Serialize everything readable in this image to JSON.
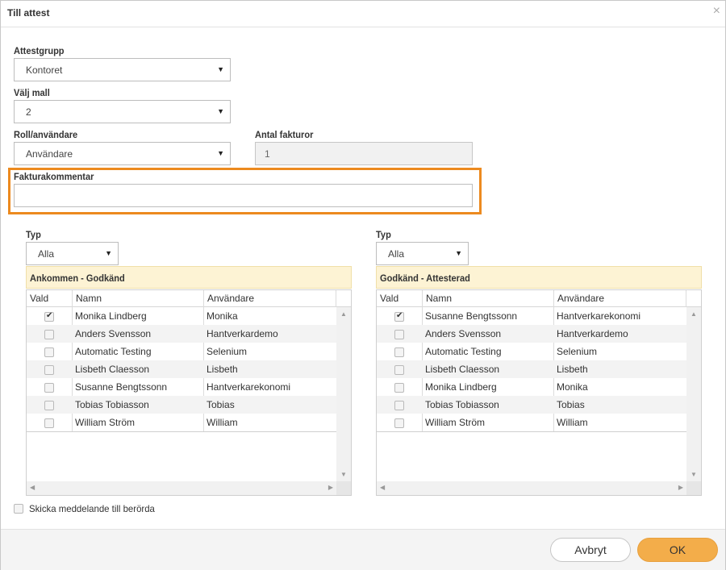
{
  "dialog": {
    "title": "Till attest",
    "close_icon": "×"
  },
  "form": {
    "attestgrupp": {
      "label": "Attestgrupp",
      "value": "Kontoret"
    },
    "valj_mall": {
      "label": "Välj mall",
      "value": "2"
    },
    "roll": {
      "label": "Roll/användare",
      "value": "Användare"
    },
    "antal_fakturor": {
      "label": "Antal fakturor",
      "value": "1"
    },
    "fakturakommentar": {
      "label": "Fakturakommentar",
      "value": "",
      "highlight_color": "#ec8a1f"
    }
  },
  "left_panel": {
    "typ_label": "Typ",
    "typ_value": "Alla",
    "header": "Ankommen - Godkänd",
    "columns": [
      "Vald",
      "Namn",
      "Användare"
    ],
    "rows": [
      {
        "checked": true,
        "namn": "Monika Lindberg",
        "anvandare": "Monika"
      },
      {
        "checked": false,
        "namn": "Anders Svensson",
        "anvandare": "Hantverkardemo"
      },
      {
        "checked": false,
        "namn": "Automatic Testing",
        "anvandare": "Selenium"
      },
      {
        "checked": false,
        "namn": "Lisbeth Claesson",
        "anvandare": "Lisbeth"
      },
      {
        "checked": false,
        "namn": "Susanne Bengtssonn",
        "anvandare": "Hantverkarekonomi"
      },
      {
        "checked": false,
        "namn": "Tobias Tobiasson",
        "anvandare": "Tobias"
      },
      {
        "checked": false,
        "namn": "William Ström",
        "anvandare": "William"
      }
    ]
  },
  "right_panel": {
    "typ_label": "Typ",
    "typ_value": "Alla",
    "header": "Godkänd - Attesterad",
    "columns": [
      "Vald",
      "Namn",
      "Användare"
    ],
    "rows": [
      {
        "checked": true,
        "namn": "Susanne Bengtssonn",
        "anvandare": "Hantverkarekonomi"
      },
      {
        "checked": false,
        "namn": "Anders Svensson",
        "anvandare": "Hantverkardemo"
      },
      {
        "checked": false,
        "namn": "Automatic Testing",
        "anvandare": "Selenium"
      },
      {
        "checked": false,
        "namn": "Lisbeth Claesson",
        "anvandare": "Lisbeth"
      },
      {
        "checked": false,
        "namn": "Monika Lindberg",
        "anvandare": "Monika"
      },
      {
        "checked": false,
        "namn": "Tobias Tobiasson",
        "anvandare": "Tobias"
      },
      {
        "checked": false,
        "namn": "William Ström",
        "anvandare": "William"
      }
    ]
  },
  "notify": {
    "label": "Skicka meddelande till berörda",
    "checked": false
  },
  "footer": {
    "cancel_label": "Avbryt",
    "ok_label": "OK",
    "ok_color": "#f3ad4a"
  }
}
